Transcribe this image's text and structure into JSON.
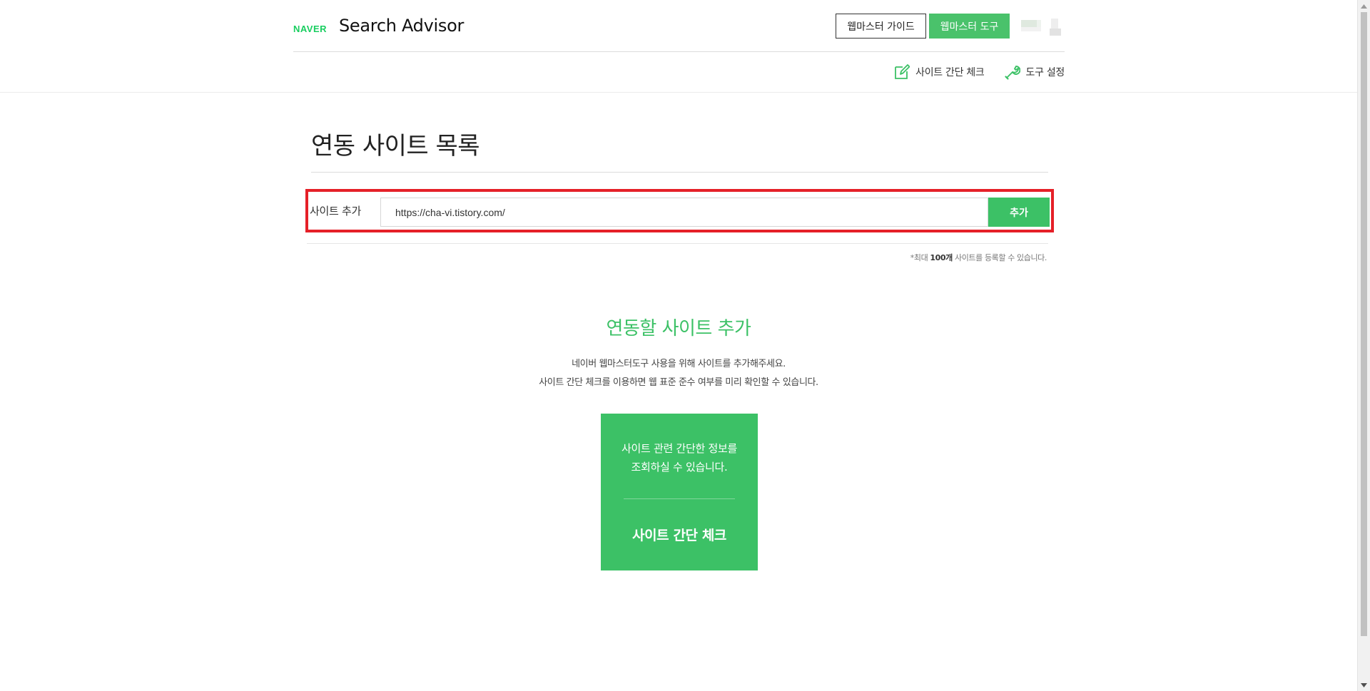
{
  "header": {
    "logo_naver": "NAVER",
    "logo_service": "Search Advisor",
    "guide_button": "웹마스터 가이드",
    "tools_button": "웹마스터 도구",
    "sub_nav": {
      "site_check": "사이트 간단 체크",
      "tool_settings": "도구 설정"
    },
    "accent_color": "#3cc166"
  },
  "main": {
    "title": "연동 사이트 목록",
    "add_site": {
      "label": "사이트 추가",
      "input_value": "https://cha-vi.tistory.com/",
      "button": "추가",
      "highlight_color": "#e52028"
    },
    "limit_note": {
      "prefix": "*최대 ",
      "count": "100개",
      "suffix": " 사이트를 등록할 수 있습니다."
    },
    "empty_state": {
      "title": "연동할 사이트 추가",
      "line1": "네이버 웹마스터도구 사용을 위해 사이트를 추가해주세요.",
      "line2": "사이트 간단 체크를 이용하면 웹 표준 준수 여부를 미리 확인할 수 있습니다."
    },
    "check_card": {
      "line1": "사이트 관련 간단한 정보를",
      "line2": "조회하실 수 있습니다.",
      "title": "사이트 간단 체크"
    }
  }
}
